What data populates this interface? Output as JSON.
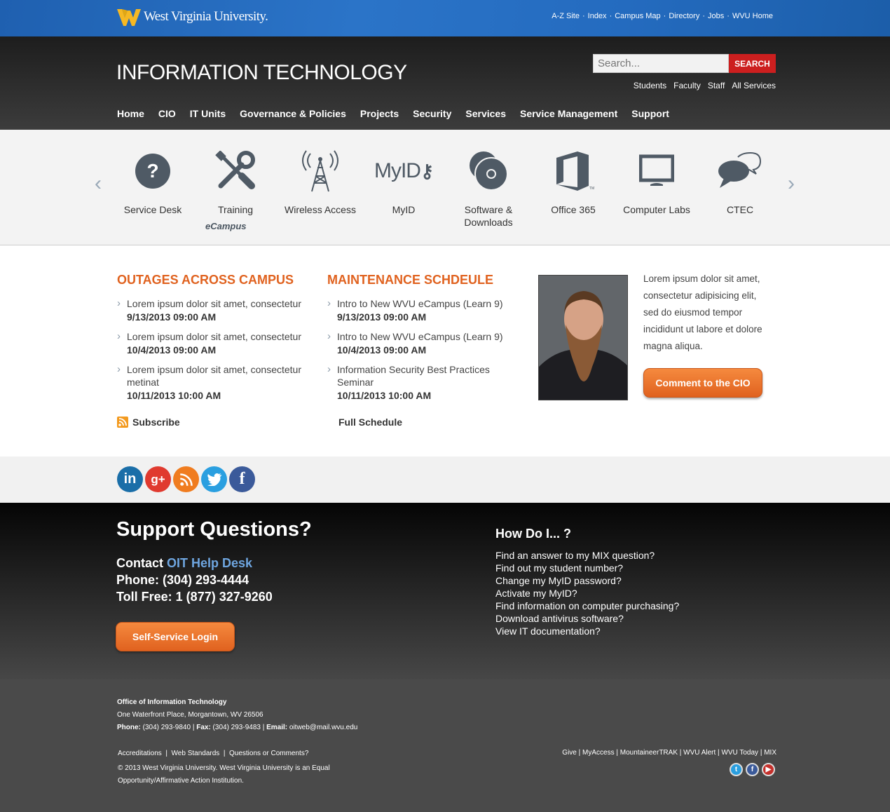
{
  "topbar": {
    "logo_text": "West Virginia University.",
    "links": [
      "A-Z Site",
      "Index",
      "Campus Map",
      "Directory",
      "Jobs",
      "WVU Home"
    ],
    "separator": "·"
  },
  "header": {
    "title": "INFORMATION TECHNOLOGY",
    "search_placeholder": "Search...",
    "search_button": "SEARCH",
    "audience_links": [
      "Students",
      "Faculty",
      "Staff",
      "All Services"
    ]
  },
  "nav": [
    "Home",
    "CIO",
    "IT Units",
    "Governance & Policies",
    "Projects",
    "Security",
    "Services",
    "Service Management",
    "Support"
  ],
  "carousel": {
    "prev": "‹",
    "next": "›",
    "items": [
      {
        "label": "Service Desk",
        "icon": "question-icon"
      },
      {
        "label": "Training",
        "icon": "tools-icon"
      },
      {
        "label": "Wireless Access",
        "icon": "antenna-icon"
      },
      {
        "label": "MyID",
        "icon": "myid-logo"
      },
      {
        "label": "Software & Downloads",
        "icon": "discs-icon"
      },
      {
        "label": "Office 365",
        "icon": "office-icon"
      },
      {
        "label": "Computer Labs",
        "icon": "monitor-icon"
      },
      {
        "label": "CTEC",
        "icon": "chat-icon"
      }
    ],
    "ecampus_label": "eCampus",
    "myid_text": "MyID"
  },
  "outages": {
    "title": "OUTAGES ACROSS CAMPUS",
    "items": [
      {
        "text": "Lorem ipsum dolor sit amet, consectetur",
        "date": "9/13/2013 09:00 AM"
      },
      {
        "text": "Lorem ipsum dolor sit amet, consectetur",
        "date": "10/4/2013 09:00 AM"
      },
      {
        "text": "Lorem ipsum dolor sit amet, consectetur metinat",
        "date": "10/11/2013 10:00 AM"
      }
    ],
    "subscribe": "Subscribe"
  },
  "maintenance": {
    "title": "MAINTENANCE SCHDEULE",
    "items": [
      {
        "text": "Intro to New WVU eCampus (Learn 9)",
        "date": "9/13/2013 09:00 AM"
      },
      {
        "text": "Intro to New WVU eCampus (Learn 9)",
        "date": "10/4/2013 09:00 AM"
      },
      {
        "text": "Information Security Best Practices Seminar",
        "date": "10/11/2013 10:00 AM"
      }
    ],
    "full_schedule": "Full Schedule"
  },
  "cio": {
    "text": "Lorem ipsum dolor sit amet, consectetur adipisicing elit, sed do eiusmod tempor incididunt ut labore et dolore magna aliqua.",
    "button": "Comment to the CIO"
  },
  "social": [
    "linkedin-icon",
    "google-plus-icon",
    "rss-icon",
    "twitter-icon",
    "facebook-icon"
  ],
  "support": {
    "title": "Support Questions?",
    "contact_prefix": "Contact ",
    "contact_link": "OIT Help Desk",
    "phone": "Phone: (304) 293-4444",
    "toll_free": "Toll Free: 1 (877) 327-9260",
    "button": "Self-Service Login",
    "howdoi_title": "How Do I... ?",
    "howdoi_links": [
      "Find an answer to my MIX question?",
      "Find out my student number?",
      "Change my MyID password?",
      "Activate my MyID?",
      "Find information on computer purchasing?",
      "Download antivirus software?",
      "View IT documentation?"
    ]
  },
  "footer": {
    "org": "Office of Information Technology",
    "address": "One Waterfront Place, Morgantown, WV 26506",
    "phone_label": "Phone:",
    "phone": " (304) 293-9840 | ",
    "fax_label": "Fax:",
    "fax": " (304) 293-9483 | ",
    "email_label": "Email:",
    "email": " oitweb@mail.wvu.edu",
    "links": [
      "Accreditations",
      "Web Standards",
      "Questions or Comments?"
    ],
    "copyright": "© 2013 West Virginia University. West Virginia University is an Equal Opportunity/Affirmative Action Institution.",
    "right_links": [
      "Give",
      "MyAccess",
      "MountaineerTRAK",
      "WVU Alert",
      "WVU Today",
      "MIX"
    ],
    "icons": [
      "twitter-icon",
      "facebook-icon",
      "youtube-icon"
    ]
  },
  "colors": {
    "accent": "#e0621f",
    "brand_blue": "#2b74c8",
    "search_red": "#cc1f1f"
  }
}
